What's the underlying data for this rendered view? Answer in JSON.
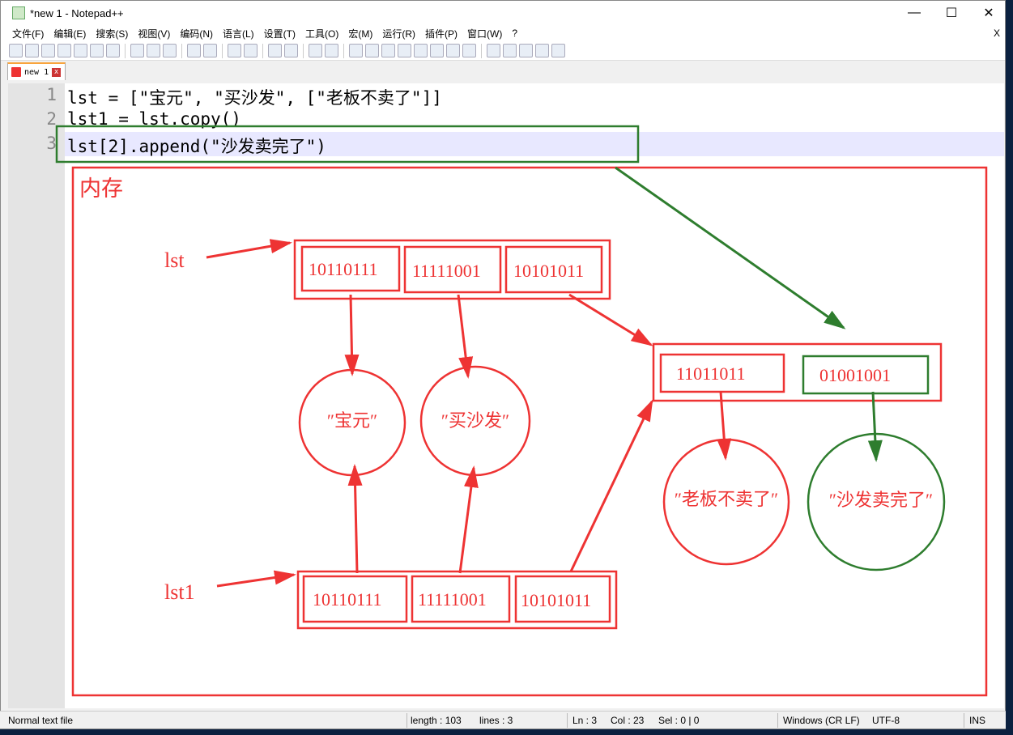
{
  "window": {
    "title": "*new 1 - Notepad++",
    "minimize": "—",
    "maximize": "☐",
    "close": "✕"
  },
  "menu": [
    "文件(F)",
    "编辑(E)",
    "搜索(S)",
    "视图(V)",
    "编码(N)",
    "语言(L)",
    "设置(T)",
    "工具(O)",
    "宏(M)",
    "运行(R)",
    "插件(P)",
    "窗口(W)",
    "?"
  ],
  "menu_close": "X",
  "tab": {
    "label": "new 1",
    "close": "x"
  },
  "editor": {
    "line_numbers": [
      "1",
      "2",
      "3"
    ],
    "lines": [
      "lst = [\"宝元\", \"买沙发\", [\"老板不卖了\"]]",
      "lst1 = lst.copy()",
      "lst[2].append(\"沙发卖完了\")"
    ]
  },
  "diagram": {
    "memory_label": "内存",
    "lst_label": "lst",
    "lst1_label": "lst1",
    "lst_cells": [
      "10110111",
      "11111001",
      "10101011"
    ],
    "lst1_cells": [
      "10110111",
      "11111001",
      "10101011"
    ],
    "inner_cells": [
      "11011011",
      "01001001"
    ],
    "circles": [
      "″宝元″",
      "″买沙发″",
      "″老板不卖了″",
      "″沙发卖完了″"
    ],
    "colors": {
      "red": "#ee3333",
      "green": "#2e7d2e"
    }
  },
  "status": {
    "type": "Normal text file",
    "length": "length : 103",
    "lines": "lines : 3",
    "ln": "Ln : 3",
    "col": "Col : 23",
    "sel": "Sel : 0 | 0",
    "eol": "Windows (CR LF)",
    "encoding": "UTF-8",
    "mode": "INS"
  }
}
